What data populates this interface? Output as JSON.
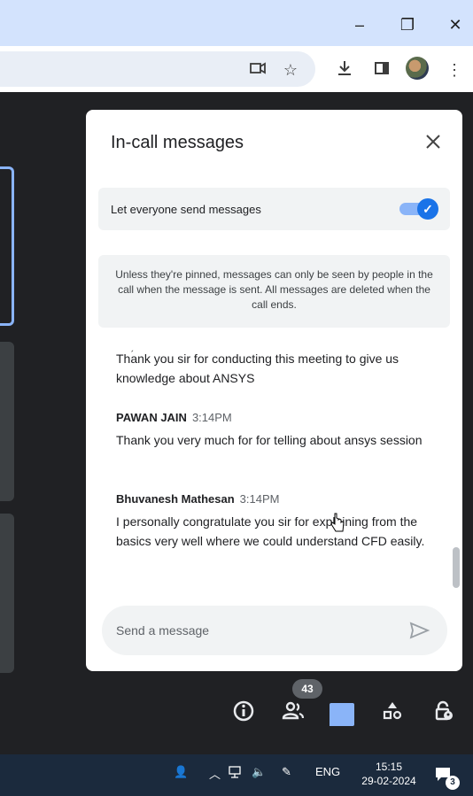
{
  "window": {
    "minimize_label": "–",
    "restore_label": "❐",
    "close_label": "✕"
  },
  "toolbar": {
    "icons": [
      "camera-icon",
      "star-icon",
      "download-icon",
      "side-panel-icon",
      "profile-avatar",
      "more-icon"
    ]
  },
  "panel": {
    "title": "In-call messages",
    "setting_label": "Let everyone send messages",
    "setting_enabled": true,
    "notice": "Unless they're pinned, messages can only be seen by people in the call when the message is sent. All messages are deleted when the call ends.",
    "messages": [
      {
        "sender": "",
        "time": "",
        "text": "Thank you sir for conducting this meeting to give us knowledge about ANSYS"
      },
      {
        "sender": "PAWAN JAIN",
        "time": "3:14PM",
        "text": "Thank you very much for  for telling about ansys session"
      },
      {
        "sender": "Bhuvanesh Mathesan",
        "time": "3:14PM",
        "text": "I personally congratulate you sir for explaining from the basics very well where we could understand CFD easily."
      }
    ],
    "composer_placeholder": "Send a message"
  },
  "controls": {
    "participants_count": "43"
  },
  "taskbar": {
    "language": "ENG",
    "time": "15:15",
    "date": "29-02-2024",
    "notification_count": "3"
  },
  "colors": {
    "meet_bg": "#202124",
    "accent": "#1a73e8",
    "chat_active": "#8ab4f8",
    "titlebar": "#d3e3fd"
  }
}
